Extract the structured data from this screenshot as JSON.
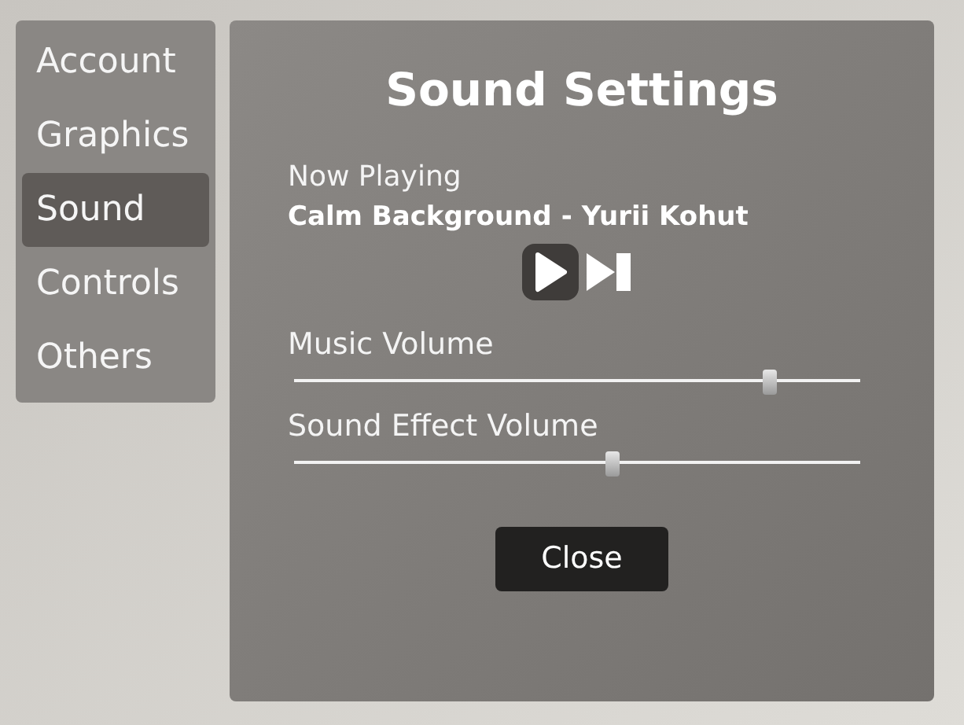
{
  "sidebar": {
    "items": [
      {
        "label": "Account",
        "selected": false
      },
      {
        "label": "Graphics",
        "selected": false
      },
      {
        "label": "Sound",
        "selected": true
      },
      {
        "label": "Controls",
        "selected": false
      },
      {
        "label": "Others",
        "selected": false
      }
    ]
  },
  "panel": {
    "title": "Sound Settings",
    "now_playing_label": "Now Playing",
    "track": "Calm Background",
    "separator": "-",
    "artist": "Yurii Kohut",
    "sliders": [
      {
        "label": "Music Volume",
        "level": 0.84
      },
      {
        "label": "Sound Effect Volume",
        "level": 0.56
      }
    ],
    "close_button": "Close"
  }
}
